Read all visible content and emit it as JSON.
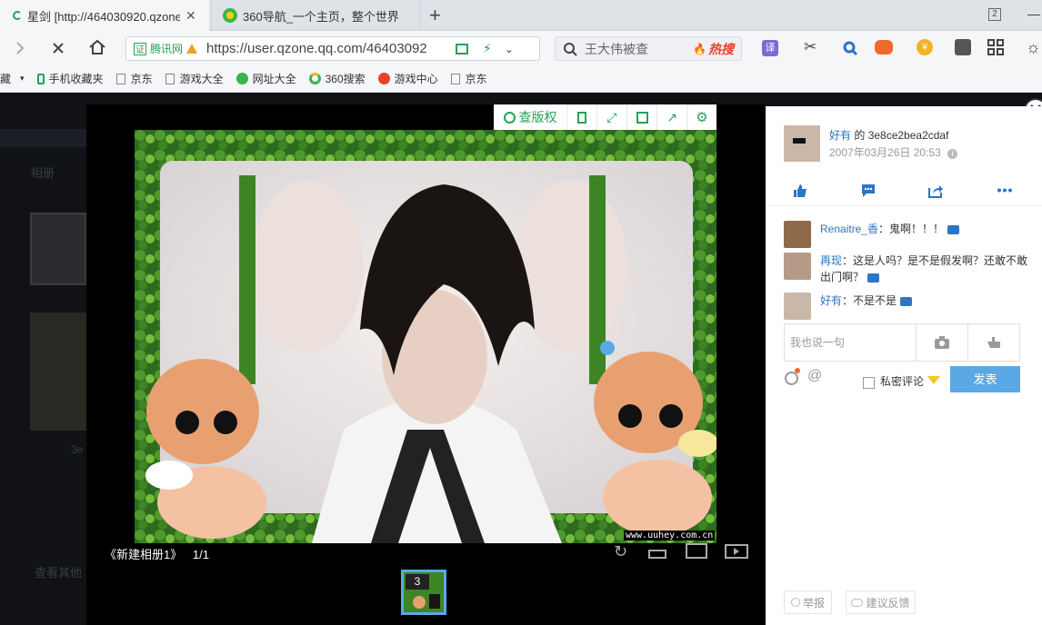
{
  "tabs": [
    {
      "label": "星剑 [http://464030920.qzone.",
      "close": "✕"
    },
    {
      "label": "360导航_一个主页，整个世界"
    }
  ],
  "tab_new": "+",
  "tab_count": "2",
  "address": {
    "site_tag": "腾讯网",
    "url": "https://user.qzone.qq.com/46403092",
    "search_placeholder": "王大伟被查",
    "hot_label": "热搜"
  },
  "bookmarks": [
    "藏",
    "手机收藏夹",
    "京东",
    "游戏大全",
    "网址大全",
    "360搜索",
    "游戏中心",
    "京东"
  ],
  "viewer": {
    "tool_label": "查版权",
    "album": "《新建相册1》",
    "page": "1/1",
    "watermark": "www.uuhey.com.cn",
    "thumb_badge": "3"
  },
  "background_text": {
    "album": "相册",
    "more": "查看其他",
    "counter": "3e"
  },
  "side": {
    "author": "好有",
    "of": " 的 ",
    "photo_id": "3e8ce2bea2cdaf",
    "datetime": "2007年03月26日 20:53",
    "comments": [
      {
        "name": "Renaitre_香",
        "text": "：鬼啊！！！"
      },
      {
        "name": "再现",
        "text": "：这是人吗？是不是假发啊？还敢不敢出门啊？"
      },
      {
        "name": "好有",
        "text": "：不是不是"
      }
    ],
    "input_placeholder": "我也说一句",
    "private_label": "私密评论",
    "submit_label": "发表",
    "report_label": "举报",
    "feedback_label": "建议反馈"
  },
  "colors": {
    "accent_green": "#2aa05a",
    "link_blue": "#2b75c4",
    "submit_blue": "#5aa9e6",
    "hot_red": "#e8412c"
  }
}
